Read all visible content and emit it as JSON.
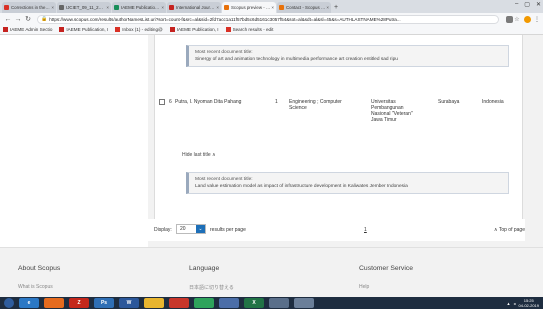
{
  "browser": {
    "tabs": [
      {
        "label": "Corrections in the publi...",
        "fav_color": "#d93025",
        "active": false
      },
      {
        "label": "IJCIET_09_11_256.pdf",
        "fav_color": "#666666",
        "active": false
      },
      {
        "label": "IAEME Publication UPLO...",
        "fav_color": "#1a8f5a",
        "active": false
      },
      {
        "label": "International Journal of ...",
        "fav_color": "#c5221f",
        "active": false
      },
      {
        "label": "Scopus preview - Scopu...",
        "fav_color": "#e8710a",
        "active": true
      },
      {
        "label": "Contact - Scopus Prev...",
        "fav_color": "#e8710a",
        "active": false
      }
    ],
    "url": "https://www.scopus.com/results/authorNamesList.uri?sort=count-f&src=al&sid=2fd7acc1a11f57bd5c6d5161c3057f54&sot=al&sdt=al&sl=45&s=AUTHLASTNAME%28Putra...",
    "bookmarks": [
      {
        "label": "IAEME Admin Sectio",
        "fav_color": "#c5221f"
      },
      {
        "label": "IAEME Publication, I",
        "fav_color": "#c5221f"
      },
      {
        "label": "Inbox (1) - editing@",
        "fav_color": "#d93025"
      },
      {
        "label": "IAEME Publication, I",
        "fav_color": "#c5221f"
      },
      {
        "label": "Search results - edit",
        "fav_color": "#d93025"
      }
    ]
  },
  "results": {
    "box1": {
      "label": "Most recent document title:",
      "title": "Sinergy of art and animation technology in multimedia performance art creation entitled sad ripu"
    },
    "row": {
      "num": "6",
      "name": "Putra, I. Nyoman Dita Pahang",
      "docs": "1",
      "area": "Engineering ; Computer Science",
      "affiliation": "Universitas Pembangunan Nasional \"Veteran\" Jawa Timur",
      "city": "Surabaya",
      "country": "Indonesia"
    },
    "hide_label": "Hide last title",
    "box2": {
      "label": "Most recent document title:",
      "title": "Land value estimation model as impact of infrastructure development in Kaliwates Jember Indonesia"
    }
  },
  "paging": {
    "display_label": "Display:",
    "per_page_value": "20",
    "per_page_label": "results per page",
    "page": "1",
    "top_label": "Top of page"
  },
  "footer": {
    "col1": "About Scopus",
    "col1_sub": "What is Scopus",
    "col2": "Language",
    "col2_sub": "日本語に切り替える",
    "col3": "Customer Service",
    "col3_sub": "Help"
  },
  "taskbar": {
    "time": "15:25",
    "date": "04-02-2019"
  }
}
